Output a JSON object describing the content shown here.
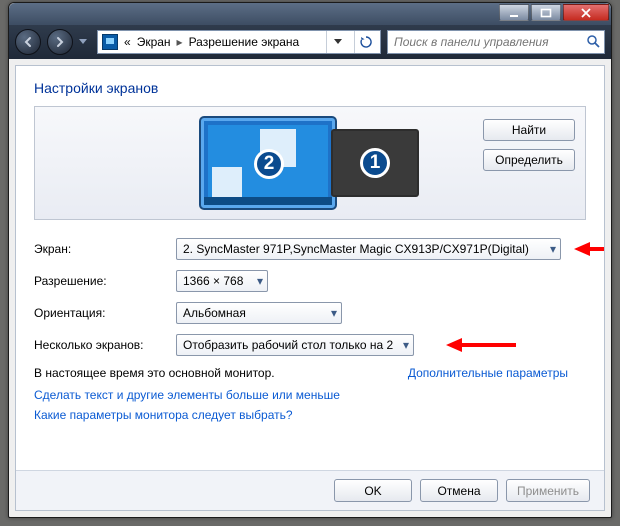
{
  "breadcrumb": {
    "item1": "Экран",
    "item2": "Разрешение экрана",
    "chevrons": "«"
  },
  "search": {
    "placeholder": "Поиск в панели управления"
  },
  "page_title": "Настройки экранов",
  "preview_buttons": {
    "detect": "Найти",
    "identify": "Определить"
  },
  "monitors": {
    "primary_badge": "1",
    "secondary_badge": "2"
  },
  "labels": {
    "display": "Экран:",
    "resolution": "Разрешение:",
    "orientation": "Ориентация:",
    "multi": "Несколько экранов:"
  },
  "values": {
    "display": "2. SyncMaster 971P,SyncMaster Magic CX913P/CX971P(Digital)",
    "resolution": "1366 × 768",
    "orientation": "Альбомная",
    "multi": "Отобразить рабочий стол только на 2"
  },
  "note_primary": "В настоящее время это основной монитор.",
  "link_advanced": "Дополнительные параметры",
  "link_textsize": "Сделать текст и другие элементы больше или меньше",
  "link_which": "Какие параметры монитора следует выбрать?",
  "footer": {
    "ok": "OK",
    "cancel": "Отмена",
    "apply": "Применить"
  }
}
